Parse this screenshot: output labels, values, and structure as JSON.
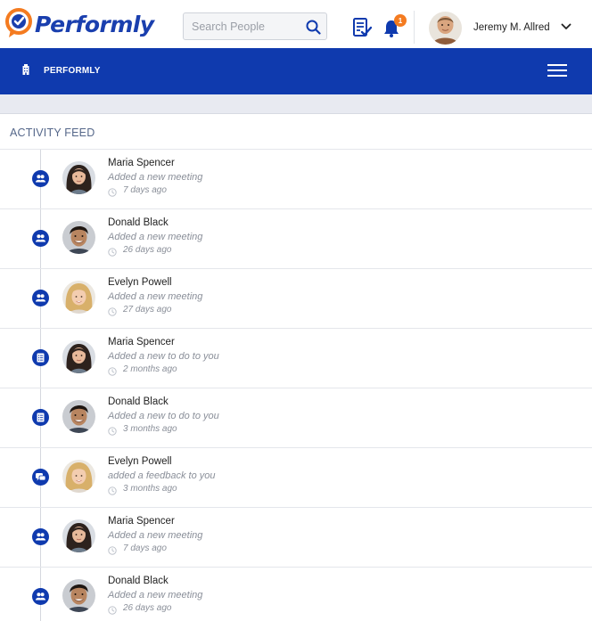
{
  "header": {
    "logo_text": "Performly",
    "search": {
      "placeholder": "Search People",
      "value": ""
    },
    "notifications_count": "1",
    "user_name": "Jeremy M. Allred"
  },
  "navbar": {
    "title": "PERFORMLY"
  },
  "feed": {
    "title": "ACTIVITY FEED",
    "items": [
      {
        "name": "Maria Spencer",
        "action": "Added a new meeting",
        "time": "7 days ago",
        "type_icon": "users-icon",
        "avatar": "woman-dark"
      },
      {
        "name": "Donald Black",
        "action": "Added a new meeting",
        "time": "26 days ago",
        "type_icon": "users-icon",
        "avatar": "man"
      },
      {
        "name": "Evelyn Powell",
        "action": "Added a new meeting",
        "time": "27 days ago",
        "type_icon": "users-icon",
        "avatar": "woman-blonde"
      },
      {
        "name": "Maria Spencer",
        "action": "Added a new to do to you",
        "time": "2 months ago",
        "type_icon": "checklist-icon",
        "avatar": "woman-dark"
      },
      {
        "name": "Donald Black",
        "action": "Added a new to do to you",
        "time": "3 months ago",
        "type_icon": "checklist-icon",
        "avatar": "man"
      },
      {
        "name": "Evelyn Powell",
        "action": "added a feedback to you",
        "time": "3 months ago",
        "type_icon": "chat-icon",
        "avatar": "woman-blonde"
      },
      {
        "name": "Maria Spencer",
        "action": "Added a new meeting",
        "time": "7 days ago",
        "type_icon": "users-icon",
        "avatar": "woman-dark"
      },
      {
        "name": "Donald Black",
        "action": "Added a new meeting",
        "time": "26 days ago",
        "type_icon": "users-icon",
        "avatar": "man"
      }
    ]
  },
  "colors": {
    "brand_blue": "#0f3aae",
    "accent_orange": "#f47b20",
    "muted_text": "#8a8f99"
  }
}
